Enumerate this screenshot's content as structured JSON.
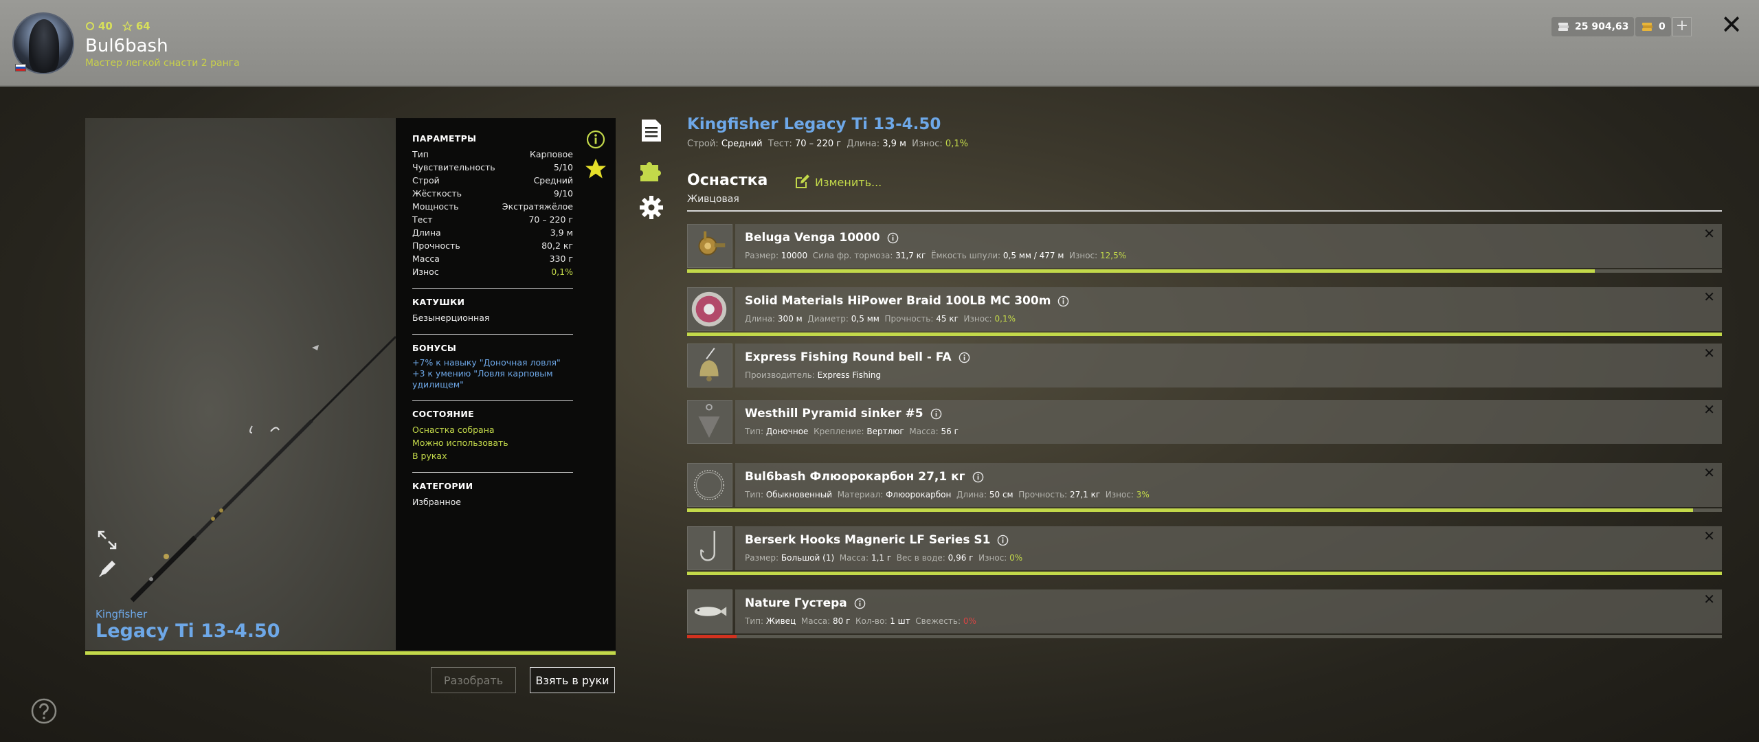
{
  "header": {
    "level": "40",
    "rating": "64",
    "player_name": "Bul6bash",
    "player_rank": "Мастер легкой снасти 2 ранга",
    "silver": "25 904,63",
    "gold": "0",
    "plus_label": "+",
    "close_label": "✕"
  },
  "rod": {
    "brand": "Kingfisher",
    "name": "Legacy Ti 13-4.50",
    "wear_percent": 100
  },
  "params": {
    "params_title": "ПАРАМЕТРЫ",
    "rows": [
      {
        "label": "Тип",
        "value": "Карповое"
      },
      {
        "label": "Чувствительность",
        "value": "5/10"
      },
      {
        "label": "Строй",
        "value": "Средний"
      },
      {
        "label": "Жёсткость",
        "value": "9/10"
      },
      {
        "label": "Мощность",
        "value": "Экстратяжёлое"
      },
      {
        "label": "Тест",
        "value": "70 – 220 г"
      },
      {
        "label": "Длина",
        "value": "3,9 м"
      },
      {
        "label": "Прочность",
        "value": "80,2 кг"
      },
      {
        "label": "Масса",
        "value": "330 г"
      },
      {
        "label": "Износ",
        "value": "0,1%"
      }
    ],
    "reels_title": "КАТУШКИ",
    "reels_value": "Безынерционная",
    "bonuses_title": "БОНУСЫ",
    "bonus_1": "+7% к навыку \"Доночная ловля\"",
    "bonus_2": "+3 к умению \"Ловля карповым удилищем\"",
    "state_title": "СОСТОЯНИЕ",
    "state_1": "Оснастка собрана",
    "state_2": "Можно использовать",
    "state_3": "В руках",
    "categories_title": "КАТЕГОРИИ",
    "categories_value": "Избранное"
  },
  "buttons": {
    "disassemble": "Разобрать",
    "take": "Взять в руки"
  },
  "item": {
    "title": "Kingfisher Legacy Ti 13-4.50",
    "action_label": "Строй:",
    "action_value": "Средний",
    "test_label": "Тест:",
    "test_value": "70 – 220 г",
    "length_label": "Длина:",
    "length_value": "3,9 м",
    "wear_label": "Износ:",
    "wear_value": "0,1%"
  },
  "rig": {
    "title": "Оснастка",
    "type": "Живцовая",
    "change_label": "Изменить..."
  },
  "parts": [
    {
      "name": "Beluga Venga 10000",
      "icon": "reel-icon",
      "wear_fraction": 0.877,
      "wear_color": "#c3d94a",
      "specs": [
        {
          "label": "Размер:",
          "value": "10000"
        },
        {
          "label": "Сила фр. тормоза:",
          "value": "31,7 кг"
        },
        {
          "label": "Ёмкость шпули:",
          "value": "0,5 мм / 477 м"
        },
        {
          "label": "Износ:",
          "value": "12,5%",
          "tone": "g"
        }
      ]
    },
    {
      "name": "Solid Materials HiPower Braid 100LB MC 300m",
      "icon": "line-spool-icon",
      "wear_fraction": 1.0,
      "wear_color": "#c3d94a",
      "specs": [
        {
          "label": "Длина:",
          "value": "300 м"
        },
        {
          "label": "Диаметр:",
          "value": "0,5 мм"
        },
        {
          "label": "Прочность:",
          "value": "45 кг"
        },
        {
          "label": "Износ:",
          "value": "0,1%",
          "tone": "g"
        }
      ]
    },
    {
      "name": "Express Fishing Round bell - FA",
      "icon": "bell-icon",
      "wear_fraction": null,
      "specs": [
        {
          "label": "Производитель:",
          "value": "Express Fishing"
        }
      ]
    },
    {
      "name": "Westhill Pyramid sinker #5",
      "icon": "sinker-icon",
      "wear_fraction": null,
      "specs": [
        {
          "label": "Тип:",
          "value": "Доночное"
        },
        {
          "label": "Крепление:",
          "value": "Вертлюг"
        },
        {
          "label": "Масса:",
          "value": "56 г"
        }
      ]
    },
    {
      "name": "Bul6bash Флюорокарбон 27,1 кг",
      "icon": "leader-icon",
      "wear_fraction": 0.972,
      "wear_color": "#c3d94a",
      "specs": [
        {
          "label": "Тип:",
          "value": "Обыкновенный"
        },
        {
          "label": "Материал:",
          "value": "Флюорокарбон"
        },
        {
          "label": "Длина:",
          "value": "50 см"
        },
        {
          "label": "Прочность:",
          "value": "27,1 кг"
        },
        {
          "label": "Износ:",
          "value": "3%",
          "tone": "g"
        }
      ]
    },
    {
      "name": "Berserk Hooks Magneric LF Series S1",
      "icon": "hook-icon",
      "wear_fraction": 1.0,
      "wear_color": "#c3d94a",
      "specs": [
        {
          "label": "Размер:",
          "value": "Большой (1)"
        },
        {
          "label": "Масса:",
          "value": "1,1 г"
        },
        {
          "label": "Вес в воде:",
          "value": "0,96 г"
        },
        {
          "label": "Износ:",
          "value": "0%",
          "tone": "g"
        }
      ]
    },
    {
      "name": "Nature Густера",
      "icon": "fish-bait-icon",
      "wear_fraction": 0.048,
      "wear_color": "#d3321f",
      "specs": [
        {
          "label": "Тип:",
          "value": "Живец"
        },
        {
          "label": "Масса:",
          "value": "80 г"
        },
        {
          "label": "Кол-во:",
          "value": "1 шт"
        },
        {
          "label": "Свежесть:",
          "value": "0%",
          "tone": "r"
        }
      ]
    }
  ],
  "colors": {
    "accent_green": "#c3d94a",
    "accent_blue": "#6ea8e8",
    "alert_red": "#d3321f"
  }
}
